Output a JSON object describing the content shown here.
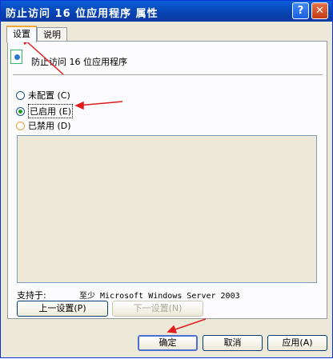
{
  "window": {
    "title": "防止访问 16 位应用程序 属性",
    "help_glyph": "?",
    "close_glyph": "✕"
  },
  "tabs": [
    {
      "label": "设置"
    },
    {
      "label": "说明"
    }
  ],
  "policy": {
    "name": "防止访问 16 位应用程序"
  },
  "options": [
    {
      "label": "未配置 (C)",
      "checked": false
    },
    {
      "label": "已启用 (E)",
      "checked": true
    },
    {
      "label": "已禁用 (D)",
      "checked": false
    }
  ],
  "support": {
    "label": "支持于:",
    "value": "至少 Microsoft Windows Server 2003"
  },
  "nav": {
    "prev_label": "上一设置(P)",
    "next_label": "下一设置(N)"
  },
  "buttons": {
    "ok_label": "确定",
    "cancel_label": "取消",
    "apply_label": "应用(A)"
  },
  "colors": {
    "title_bar": "#0a5fd8",
    "dialog_bg": "#ece9d8",
    "annotation_arrow": "#e11b1b"
  }
}
